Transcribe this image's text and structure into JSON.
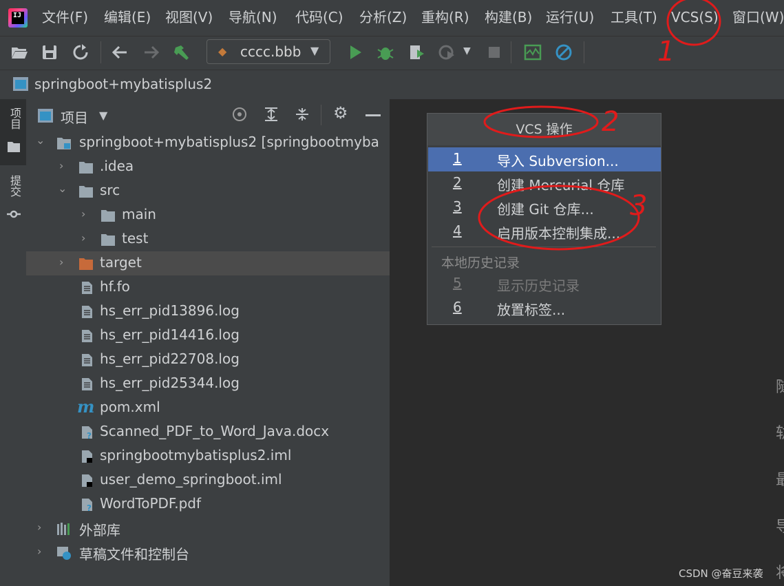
{
  "menubar": {
    "items": [
      "文件(F)",
      "编辑(E)",
      "视图(V)",
      "导航(N)",
      "代码(C)",
      "分析(Z)",
      "重构(R)",
      "构建(B)",
      "运行(U)",
      "工具(T)",
      "VCS(S)",
      "窗口(W)"
    ]
  },
  "toolbar": {
    "run_config": "cccc.bbb"
  },
  "breadcrumb": {
    "project": "springboot+mybatisplus2"
  },
  "leftstrip": {
    "project_tab": "项目",
    "commit_tab": "提交"
  },
  "panel": {
    "title": "项目",
    "tree": [
      {
        "label": "springboot+mybatisplus2 [springbootmyba",
        "icon": "module-folder-icon",
        "expanded": true
      },
      {
        "label": ".idea",
        "icon": "folder-icon",
        "expanded": false
      },
      {
        "label": "src",
        "icon": "folder-icon",
        "expanded": true
      },
      {
        "label": "main",
        "icon": "folder-icon",
        "expanded": false
      },
      {
        "label": "test",
        "icon": "folder-icon",
        "expanded": false
      },
      {
        "label": "target",
        "icon": "excluded-folder-icon",
        "expanded": false
      },
      {
        "label": "hf.fo",
        "icon": "text-file-icon"
      },
      {
        "label": "hs_err_pid13896.log",
        "icon": "text-file-icon"
      },
      {
        "label": "hs_err_pid14416.log",
        "icon": "text-file-icon"
      },
      {
        "label": "hs_err_pid22708.log",
        "icon": "text-file-icon"
      },
      {
        "label": "hs_err_pid25344.log",
        "icon": "text-file-icon"
      },
      {
        "label": "pom.xml",
        "icon": "maven-icon"
      },
      {
        "label": "Scanned_PDF_to_Word_Java.docx",
        "icon": "unknown-file-icon"
      },
      {
        "label": "springbootmybatisplus2.iml",
        "icon": "iml-file-icon"
      },
      {
        "label": "user_demo_springboot.iml",
        "icon": "iml-file-icon"
      },
      {
        "label": "WordToPDF.pdf",
        "icon": "unknown-file-icon"
      },
      {
        "label": "外部库",
        "icon": "library-icon",
        "expanded": false
      },
      {
        "label": "草稿文件和控制台",
        "icon": "scratch-icon",
        "expanded": false
      }
    ]
  },
  "popup": {
    "title": "VCS 操作",
    "items": [
      {
        "num": "1",
        "label": "导入 Subversion..."
      },
      {
        "num": "2",
        "label": "创建 Mercurial 仓库"
      },
      {
        "num": "3",
        "label": "创建 Git 仓库..."
      },
      {
        "num": "4",
        "label": "启用版本控制集成..."
      }
    ],
    "section": "本地历史记录",
    "section_items": [
      {
        "num": "5",
        "label": "显示历史记录"
      },
      {
        "num": "6",
        "label": "放置标签..."
      }
    ]
  },
  "editor": {
    "hint_chars": [
      "隧",
      "轨",
      "最",
      "导",
      "将"
    ]
  },
  "annotations": [
    "1",
    "2",
    "3"
  ],
  "watermark": "CSDN @奋豆来袭",
  "colors": {
    "selection": "#4b6eaf",
    "annotation": "#e01b1b",
    "run": "#499c54"
  }
}
